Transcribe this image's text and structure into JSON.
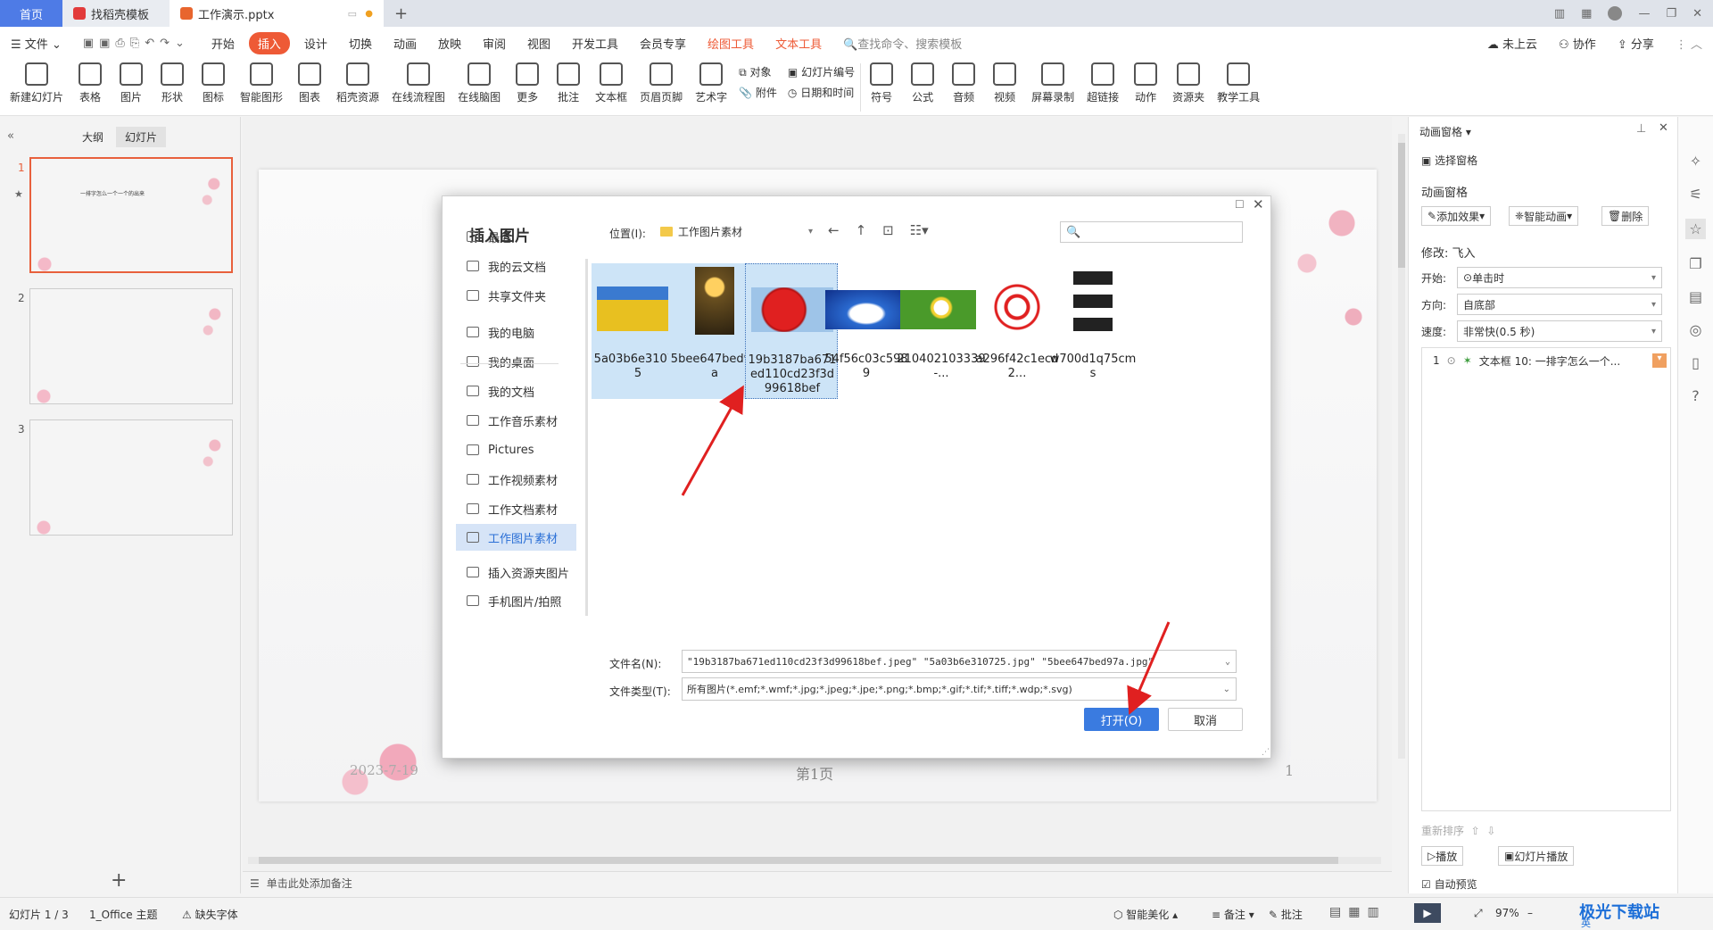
{
  "tabs": {
    "home": "首页",
    "template": "找稻壳模板",
    "document": "工作演示.pptx"
  },
  "menu": {
    "file": "文件",
    "items": [
      "开始",
      "插入",
      "设计",
      "切换",
      "动画",
      "放映",
      "审阅",
      "视图",
      "开发工具",
      "会员专享"
    ],
    "active": "插入",
    "special": [
      "绘图工具",
      "文本工具"
    ],
    "search": "查找命令、搜索模板",
    "cloud": "未上云",
    "collab": "协作",
    "share": "分享"
  },
  "ribbon": {
    "buttons": [
      "新建幻灯片",
      "表格",
      "图片",
      "形状",
      "图标",
      "智能图形",
      "图表",
      "稻壳资源",
      "在线流程图",
      "在线脑图",
      "更多",
      "批注",
      "文本框",
      "页眉页脚",
      "艺术字"
    ],
    "small1": [
      "对象",
      "附件"
    ],
    "small2": [
      "幻灯片编号",
      "日期和时间"
    ],
    "buttons2": [
      "符号",
      "公式",
      "音频",
      "视频",
      "屏幕录制",
      "超链接",
      "动作",
      "资源夹",
      "教学工具"
    ]
  },
  "leftpane": {
    "outline": "大纲",
    "slides": "幻灯片",
    "numbers": [
      "1",
      "2",
      "3"
    ],
    "thumb_title": "一排字怎么一个一个的出来"
  },
  "slide": {
    "date": "2023-7-19",
    "page": "第1页",
    "number": "1"
  },
  "notes": "单击此处添加备注",
  "dialog": {
    "title": "插入图片",
    "location_label": "位置(I):",
    "location": "工作图片素材",
    "sidebar": [
      "最近",
      "我的云文档",
      "共享文件夹",
      "我的电脑",
      "我的桌面",
      "我的文档",
      "工作音乐素材",
      "Pictures",
      "工作视频素材",
      "工作文档素材",
      "工作图片素材",
      "插入资源夹图片",
      "手机图片/拍照"
    ],
    "files": [
      "5a03b6e310725",
      "5bee647bed97a",
      "19b3187ba671ed110cd23f3d99618bef",
      "54f56c03c5989",
      "210402103339-...",
      "a296f42c1ecd2...",
      "w700d1q75cms"
    ],
    "filename_label": "文件名(N):",
    "filename": "\"19b3187ba671ed110cd23f3d99618bef.jpeg\" \"5a03b6e310725.jpg\" \"5bee647bed97a.jpg\"",
    "filetype_label": "文件类型(T):",
    "filetype": "所有图片(*.emf;*.wmf;*.jpg;*.jpeg;*.jpe;*.png;*.bmp;*.gif;*.tif;*.tiff;*.wdp;*.svg)",
    "open": "打开(O)",
    "cancel": "取消",
    "accent": "#3a7be0"
  },
  "anim": {
    "pane_title": "动画窗格",
    "select_pane": "选择窗格",
    "section": "动画窗格",
    "add_effect": "添加效果",
    "smart_anim": "智能动画",
    "delete": "删除",
    "modify": "修改: 飞入",
    "start_label": "开始:",
    "start": "单击时",
    "direction_label": "方向:",
    "direction": "自底部",
    "speed_label": "速度:",
    "speed": "非常快(0.5 秒)",
    "item": "文本框 10: 一排字怎么一个...",
    "item_num": "1",
    "reorder": "重新排序",
    "play": "播放",
    "slideshow": "幻灯片播放",
    "autopreview": "自动预览"
  },
  "status": {
    "slide": "幻灯片 1 / 3",
    "theme": "1_Office 主题",
    "font": "缺失字体",
    "beautify": "智能美化",
    "notes": "备注",
    "comment": "批注",
    "zoom": "97%",
    "watermark": "极光下载站",
    "ime": "英"
  }
}
